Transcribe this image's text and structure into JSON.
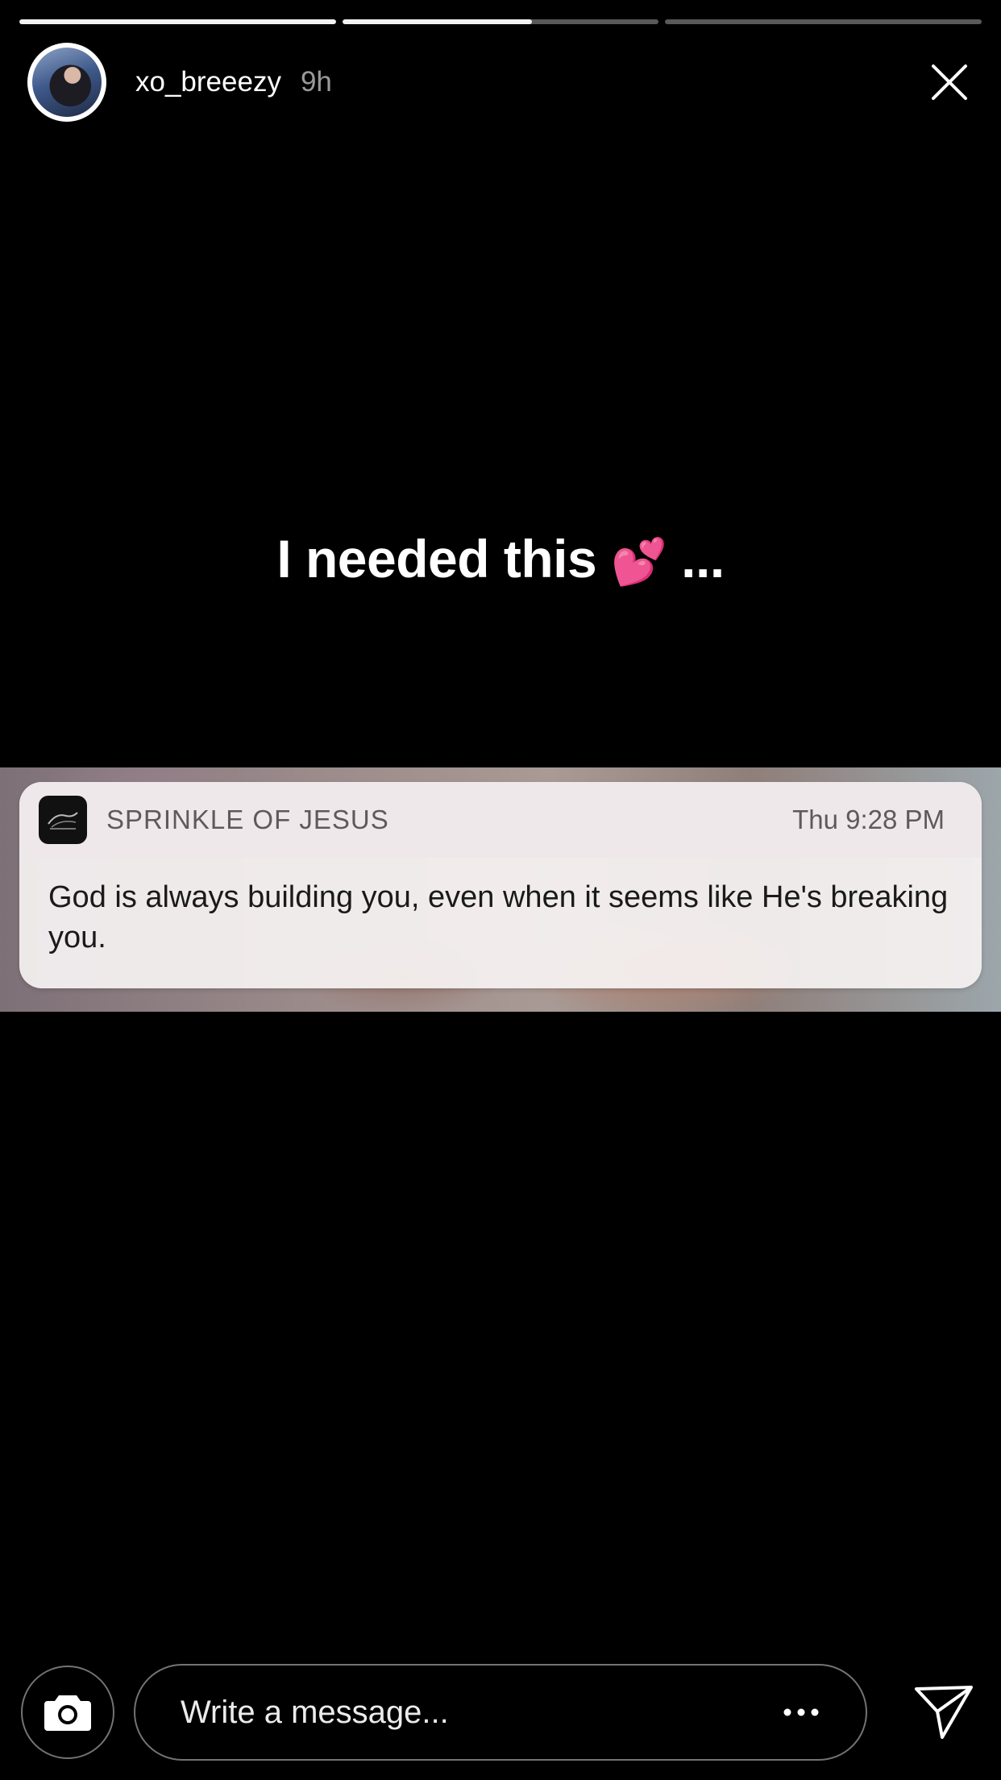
{
  "story": {
    "progress": [
      1.0,
      0.6,
      0.0
    ],
    "user": {
      "username": "xo_breeezy",
      "time_ago": "9h",
      "avatar_icon": "profile-photo"
    },
    "close_icon": "close-icon",
    "caption": {
      "text": "I needed this",
      "emoji": "💕",
      "trailing": " ..."
    }
  },
  "notification": {
    "app_name": "SPRINKLE OF JESUS",
    "time": "Thu 9:28 PM",
    "message": "God is always building you, even when it seems like He's breaking you.",
    "app_icon": "sprinkle-of-jesus-app-icon"
  },
  "reply_bar": {
    "placeholder": "Write a message...",
    "camera_icon": "camera-icon",
    "more_icon": "ellipsis-icon",
    "send_icon": "send-icon"
  },
  "colors": {
    "background": "#000000",
    "text": "#ffffff",
    "heart": "#ff4fa6",
    "card": "#f6f2f2"
  }
}
